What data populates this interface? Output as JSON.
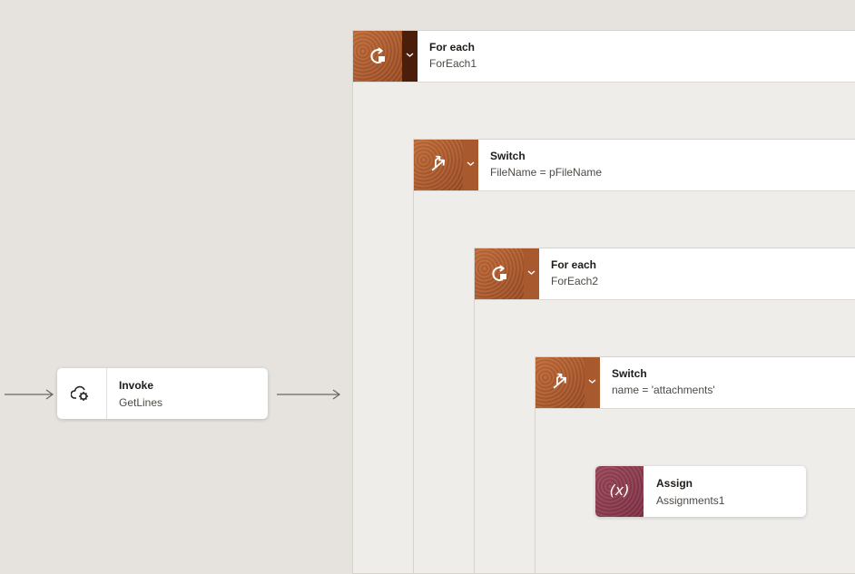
{
  "invoke": {
    "title": "Invoke",
    "subtitle": "GetLines",
    "icon": "cloud-gear-icon"
  },
  "foreach1": {
    "title": "For each",
    "subtitle": "ForEach1",
    "icon": "loop-icon"
  },
  "switch1": {
    "title": "Switch",
    "subtitle": "FileName = pFileName",
    "icon": "switch-icon"
  },
  "foreach2": {
    "title": "For each",
    "subtitle": "ForEach2",
    "icon": "loop-icon"
  },
  "switch2": {
    "title": "Switch",
    "subtitle": "name = 'attachments'",
    "icon": "switch-icon"
  },
  "assign": {
    "title": "Assign",
    "subtitle": "Assignments1",
    "icon": "variable-icon",
    "icon_text": "(x)"
  },
  "colors": {
    "action_accent": "#a85a2e",
    "assign_accent": "#8b3a4d",
    "canvas": "#e6e3de"
  }
}
